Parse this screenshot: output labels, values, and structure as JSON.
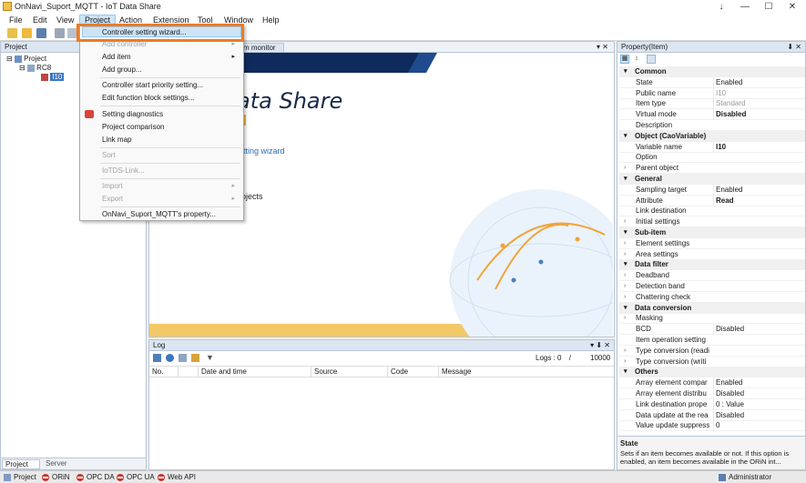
{
  "window": {
    "title": "OnNavi_Suport_MQTT - IoT Data Share",
    "pin_glyph": "↓",
    "minimize_glyph": "—",
    "maximize_glyph": "☐",
    "close_glyph": "✕"
  },
  "menu": [
    "File",
    "Edit",
    "View",
    "Project",
    "Action",
    "Extension",
    "Tool",
    "Window",
    "Help"
  ],
  "project_panel": {
    "title": "Project",
    "controls": "▾ ✕",
    "tree": [
      {
        "label": "Project",
        "expander": "⊟"
      },
      {
        "label": "RC8",
        "expander": "⊟"
      },
      {
        "label": "I10",
        "expander": ""
      }
    ],
    "tabs": [
      "Project",
      "Server"
    ]
  },
  "dropdown": {
    "items": [
      {
        "label": "Controller setting wizard...",
        "disabled": false,
        "submenu": false
      },
      {
        "label": "Add controller",
        "disabled": true,
        "submenu": true
      },
      {
        "label": "Add item",
        "disabled": false,
        "submenu": true
      },
      {
        "label": "Add group...",
        "disabled": false,
        "submenu": false
      },
      {
        "label": "Controller start priority setting...",
        "disabled": false,
        "submenu": false
      },
      {
        "label": "Edit function block settings...",
        "disabled": false,
        "submenu": false
      },
      {
        "label": "Setting diagnostics",
        "disabled": false,
        "submenu": false
      },
      {
        "label": "Project comparison",
        "disabled": false,
        "submenu": false
      },
      {
        "label": "Link map",
        "disabled": false,
        "submenu": false
      },
      {
        "label": "Sort",
        "disabled": true,
        "submenu": false
      },
      {
        "label": "IoTDS-Link...",
        "disabled": true,
        "submenu": false
      },
      {
        "label": "Import",
        "disabled": true,
        "submenu": true
      },
      {
        "label": "Export",
        "disabled": true,
        "submenu": true
      },
      {
        "label": "OnNavi_Suport_MQTT's property...",
        "disabled": false,
        "submenu": false
      }
    ],
    "arrow": "▸"
  },
  "center": {
    "tab_label": "m monitor",
    "tab_controls": "▾ ✕",
    "banner_title": "ata Share",
    "link_wizard": "etting wizard",
    "link_projects": "rojects"
  },
  "log": {
    "title": "Log",
    "controls": "▾ ⬇ ✕",
    "logs_label": "Logs :",
    "logs_count": "0",
    "slash": "/",
    "logs_max": "10000",
    "columns": [
      "No.",
      "",
      "Date and time",
      "Source",
      "Code",
      "Message"
    ]
  },
  "property": {
    "title": "Property(Item)",
    "controls": "⬇ ✕",
    "rows": [
      {
        "t": "cat",
        "name": "Common"
      },
      {
        "t": "row",
        "name": "State",
        "value": "Enabled",
        "style": ""
      },
      {
        "t": "row",
        "name": "Public name",
        "value": "I10",
        "style": "gray"
      },
      {
        "t": "row",
        "name": "Item type",
        "value": "Standard",
        "style": "gray"
      },
      {
        "t": "row",
        "name": "Virtual mode",
        "value": "Disabled",
        "style": "bold"
      },
      {
        "t": "row",
        "name": "Description",
        "value": "",
        "style": ""
      },
      {
        "t": "cat",
        "name": "Object (CaoVariable)"
      },
      {
        "t": "row",
        "name": "Variable name",
        "value": "I10",
        "style": "bold"
      },
      {
        "t": "row",
        "name": "Option",
        "value": "",
        "style": ""
      },
      {
        "t": "row",
        "name": "Parent object",
        "value": "",
        "style": "",
        "expand": true
      },
      {
        "t": "cat",
        "name": "General"
      },
      {
        "t": "row",
        "name": "Sampling target",
        "value": "Enabled",
        "style": ""
      },
      {
        "t": "row",
        "name": "Attribute",
        "value": "Read",
        "style": "bold"
      },
      {
        "t": "row",
        "name": "Link destination",
        "value": "",
        "style": ""
      },
      {
        "t": "row",
        "name": "Initial settings",
        "value": "",
        "style": "",
        "expand": true
      },
      {
        "t": "cat",
        "name": "Sub-item"
      },
      {
        "t": "row",
        "name": "Element settings",
        "value": "",
        "style": "",
        "expand": true
      },
      {
        "t": "row",
        "name": "Area settings",
        "value": "",
        "style": "",
        "expand": true
      },
      {
        "t": "cat",
        "name": "Data filter"
      },
      {
        "t": "row",
        "name": "Deadband",
        "value": "",
        "style": "",
        "expand": true
      },
      {
        "t": "row",
        "name": "Detection band",
        "value": "",
        "style": "",
        "expand": true
      },
      {
        "t": "row",
        "name": "Chattering check",
        "value": "",
        "style": "",
        "expand": true
      },
      {
        "t": "cat",
        "name": "Data conversion"
      },
      {
        "t": "row",
        "name": "Masking",
        "value": "",
        "style": "",
        "expand": true
      },
      {
        "t": "row",
        "name": "BCD",
        "value": "Disabled",
        "style": ""
      },
      {
        "t": "row",
        "name": "Item operation setting",
        "value": "",
        "style": ""
      },
      {
        "t": "row",
        "name": "Type conversion (readi",
        "value": "",
        "style": "",
        "expand": true
      },
      {
        "t": "row",
        "name": "Type conversion (writi",
        "value": "",
        "style": "",
        "expand": true
      },
      {
        "t": "cat",
        "name": "Others"
      },
      {
        "t": "row",
        "name": "Array element compar",
        "value": "Enabled",
        "style": ""
      },
      {
        "t": "row",
        "name": "Array element distribu",
        "value": "Disabled",
        "style": ""
      },
      {
        "t": "row",
        "name": "Link destination prope",
        "value": "0 : Value",
        "style": ""
      },
      {
        "t": "row",
        "name": "Data update at the rea",
        "value": "Disabled",
        "style": ""
      },
      {
        "t": "row",
        "name": "Value update suppress",
        "value": "0",
        "style": ""
      }
    ],
    "desc_title": "State",
    "desc_text": "Sets if an item becomes available or not. If this option is enabled, an item becomes available in the ORiN int..."
  },
  "statusbar": {
    "items": [
      "Project",
      "ORiN",
      "OPC DA",
      "OPC UA",
      "Web API"
    ],
    "user": "Administrator"
  },
  "colors": {
    "accent_orange": "#ee7b23",
    "banner_navy": "#0f2a5c",
    "banner_gold": "#f3b338",
    "status_red": "#c9342b",
    "link_blue": "#2d6bb5"
  }
}
